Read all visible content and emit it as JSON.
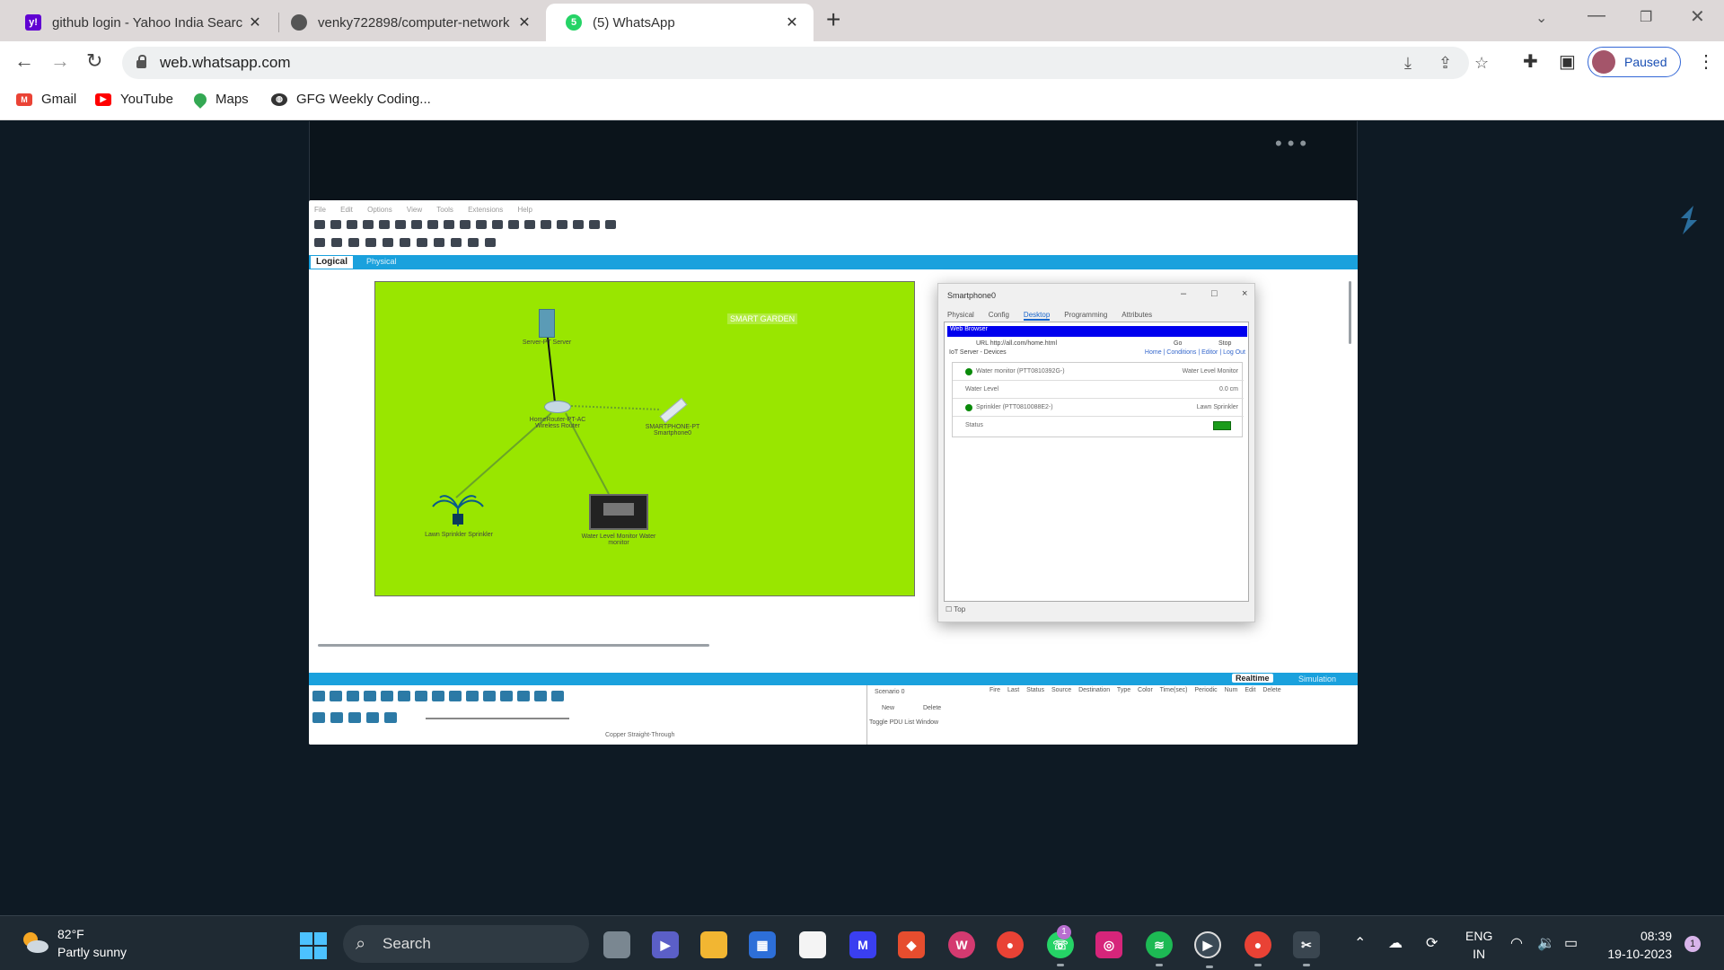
{
  "browser": {
    "tabs": [
      {
        "title": "github login - Yahoo India Searc",
        "favicon": "yahoo-icon"
      },
      {
        "title": "venky722898/computer-network",
        "favicon": "github-icon"
      },
      {
        "title": "(5) WhatsApp",
        "favicon": "whatsapp-icon",
        "active": true,
        "badge": "5"
      }
    ],
    "url": "web.whatsapp.com",
    "profile_status": "Paused",
    "bookmarks": [
      {
        "label": "Gmail",
        "icon": "gmail-icon"
      },
      {
        "label": "YouTube",
        "icon": "youtube-icon"
      },
      {
        "label": "Maps",
        "icon": "maps-icon"
      },
      {
        "label": "GFG Weekly Coding...",
        "icon": "globe-icon"
      }
    ]
  },
  "media": {
    "menu_text": "File Edit Options View Tools Extensions Help",
    "logical_tab": "Logical",
    "physical_tab": "Physical",
    "canvas_label": "SMART GARDEN",
    "devices": {
      "server": "Server-PT Server",
      "router": "HomeRouter-PT-AC Wireless Router",
      "phone": "SMARTPHONE-PT Smartphone0",
      "sprinkler": "Lawn Sprinkler Sprinkler",
      "monitor": "Water Level Monitor Water monitor"
    },
    "dialog": {
      "title": "Smartphone0",
      "tabs": [
        "Physical",
        "Config",
        "Desktop",
        "Programming",
        "Attributes"
      ],
      "browser_title": "Web Browser",
      "url_line": "URL  http://all.com/home.html",
      "go": "Go",
      "stop": "Stop",
      "server_line": "IoT Server - Devices",
      "server_links": "Home | Conditions | Editor | Log Out",
      "rows": [
        {
          "left": "Water monitor (PTT0810392G-)",
          "right": "Water Level Monitor",
          "dot": true
        },
        {
          "left": "Water Level",
          "right": "0.0 cm",
          "dot": false
        },
        {
          "left": "Sprinkler (PTT0810088E2-)",
          "right": "Lawn Sprinkler",
          "dot": true
        },
        {
          "left": "Status",
          "right": "",
          "dot": false
        }
      ],
      "top_checkbox": "Top"
    },
    "realtime": "Realtime",
    "simulation": "Simulation",
    "pdu_headers": "Fire Last Status Source Destination Type Color Time(sec) Periodic Num Edit Delete",
    "scenario": "Scenario 0",
    "new_btn": "New",
    "delete_btn": "Delete",
    "toggle": "Toggle PDU List Window",
    "cable": "Copper Straight-Through"
  },
  "taskbar": {
    "temp": "82°F",
    "weather": "Partly sunny",
    "search": "Search",
    "lang1": "ENG",
    "lang2": "IN",
    "time": "08:39",
    "date": "19-10-2023",
    "notifications": "1",
    "whatsapp_badge": "1"
  }
}
